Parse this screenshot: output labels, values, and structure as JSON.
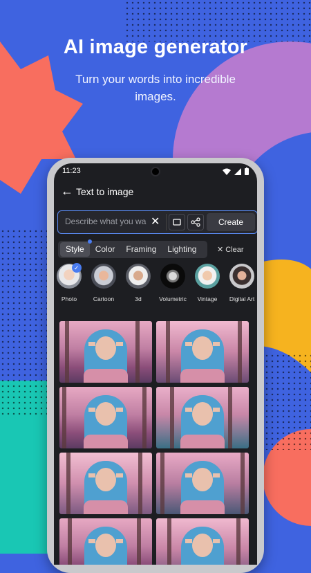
{
  "headline": {
    "title": "AI image generator",
    "subtitle_line1": "Turn your words into incredible",
    "subtitle_line2": "images."
  },
  "status_bar": {
    "time": "11:23"
  },
  "app_bar": {
    "title": "Text to image"
  },
  "prompt": {
    "placeholder": "Describe what you want",
    "create_label": "Create"
  },
  "tabs": [
    {
      "label": "Style",
      "active": true
    },
    {
      "label": "Color",
      "active": false
    },
    {
      "label": "Framing",
      "active": false
    },
    {
      "label": "Lighting",
      "active": false
    }
  ],
  "clear_label": "Clear",
  "styles": [
    {
      "label": "Photo",
      "selected": true
    },
    {
      "label": "Cartoon",
      "selected": false
    },
    {
      "label": "3d",
      "selected": false
    },
    {
      "label": "Volumetric",
      "selected": false
    },
    {
      "label": "Vintage",
      "selected": false
    },
    {
      "label": "Digital Art",
      "selected": false
    }
  ],
  "colors": {
    "accent": "#4a7cf0",
    "background_blue": "#3f63e0",
    "coral": "#f86e5f",
    "purple": "#b57ad0",
    "yellow": "#f6b31f",
    "teal": "#19c7b4"
  }
}
